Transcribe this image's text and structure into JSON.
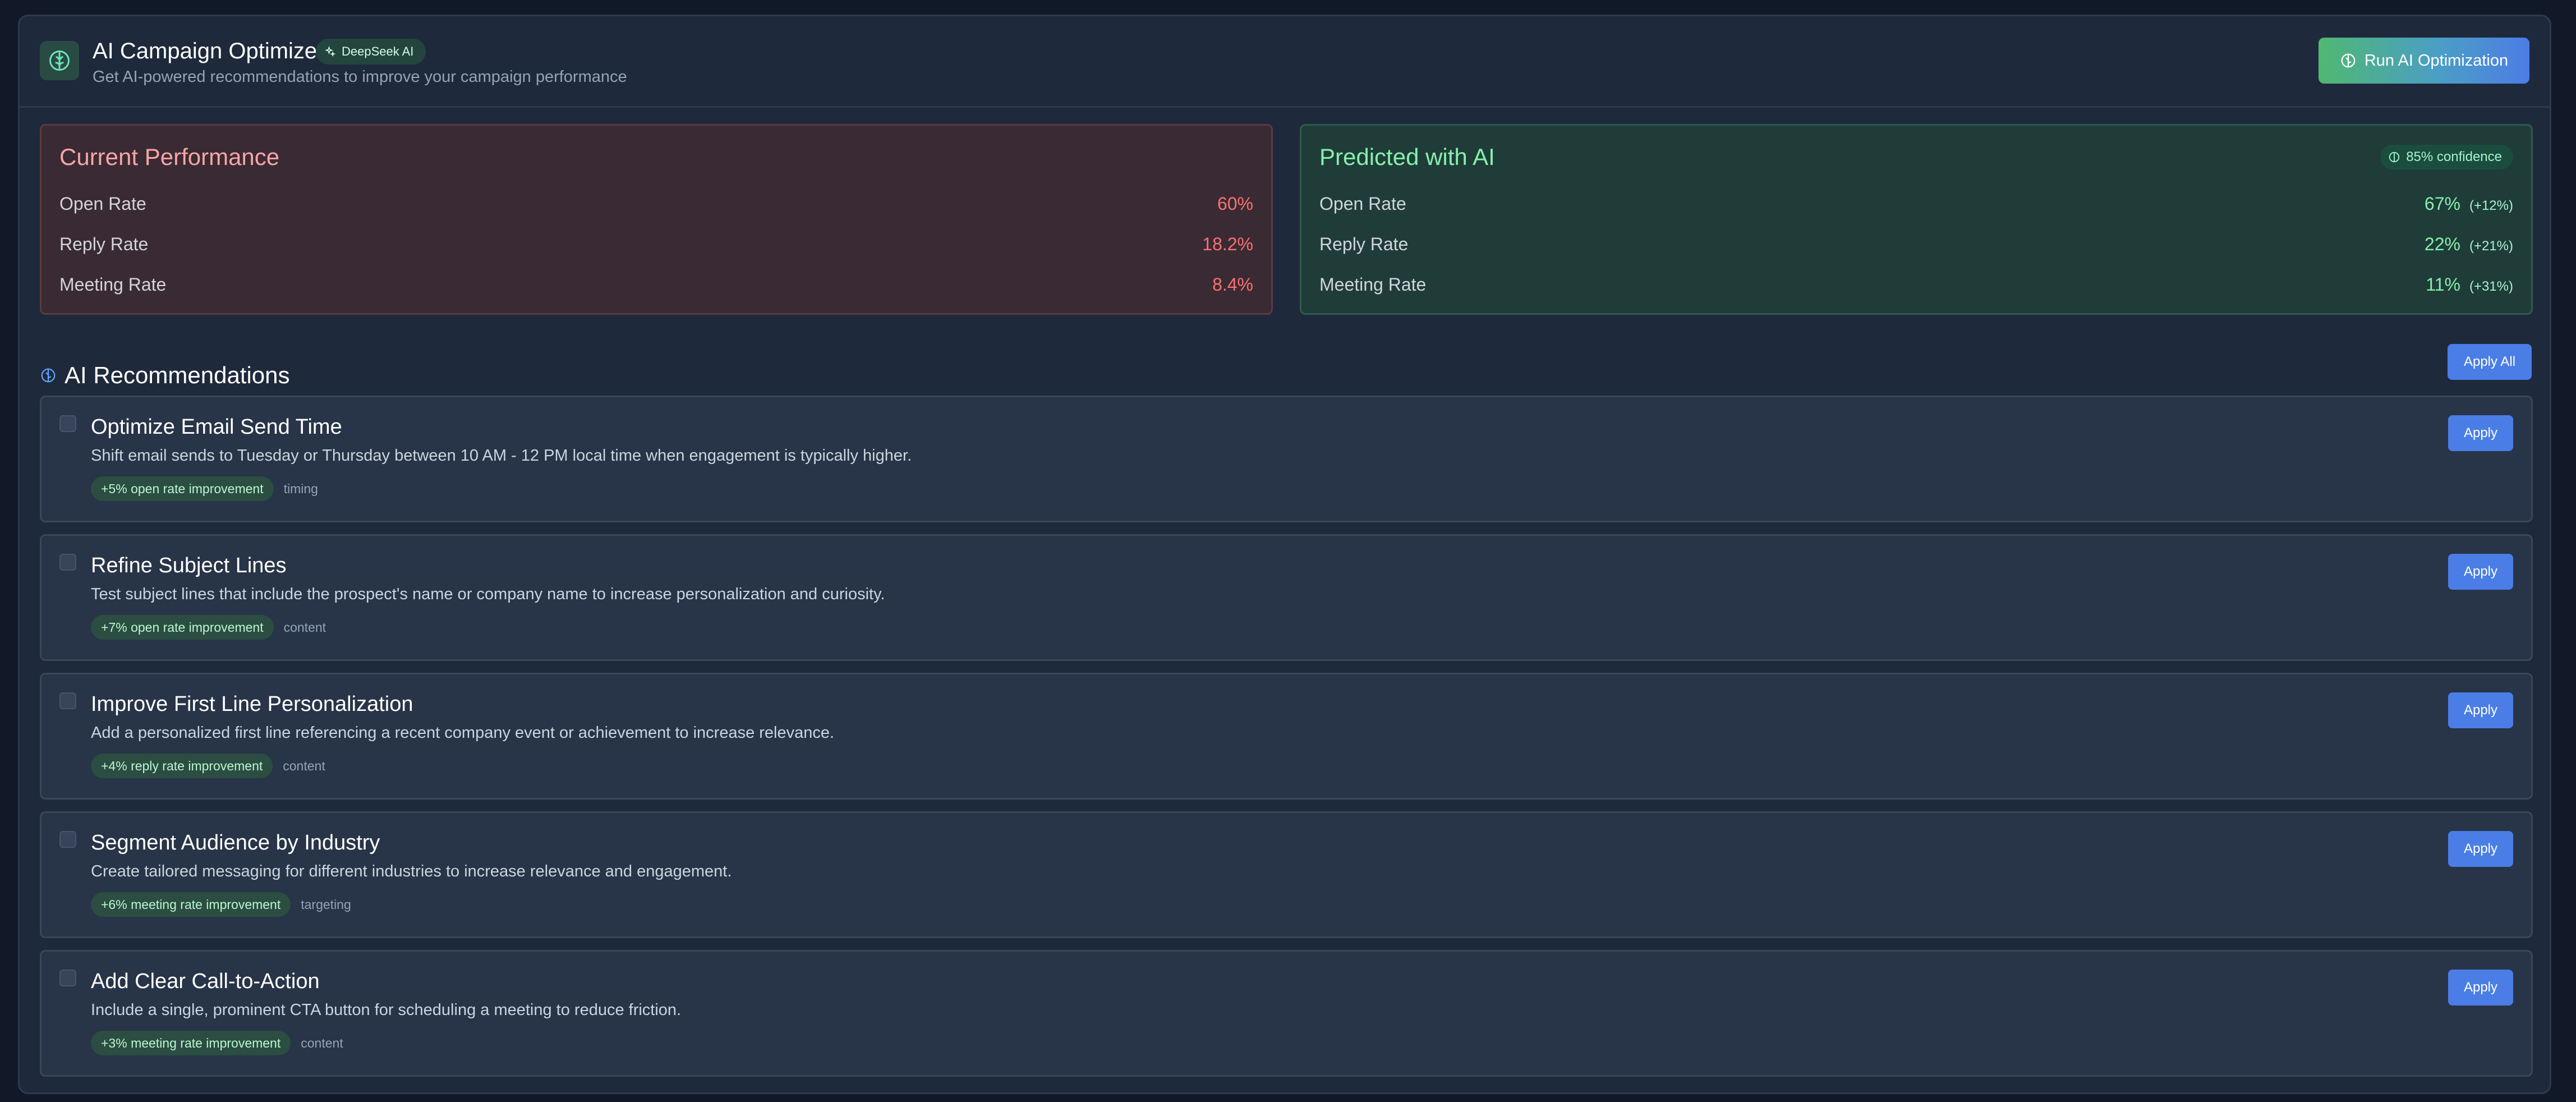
{
  "header": {
    "title": "AI Campaign Optimizer",
    "badge": "DeepSeek AI",
    "subtitle": "Get AI-powered recommendations to improve your campaign performance",
    "run_button": "Run AI Optimization"
  },
  "current": {
    "title": "Current Performance",
    "metrics": [
      {
        "label": "Open Rate",
        "value": "60%"
      },
      {
        "label": "Reply Rate",
        "value": "18.2%"
      },
      {
        "label": "Meeting Rate",
        "value": "8.4%"
      }
    ]
  },
  "predicted": {
    "title": "Predicted with AI",
    "confidence": "85% confidence",
    "metrics": [
      {
        "label": "Open Rate",
        "value": "67%",
        "delta": "(+12%)"
      },
      {
        "label": "Reply Rate",
        "value": "22%",
        "delta": "(+21%)"
      },
      {
        "label": "Meeting Rate",
        "value": "11%",
        "delta": "(+31%)"
      }
    ]
  },
  "recommendations": {
    "title": "AI Recommendations",
    "apply_all": "Apply All",
    "apply_label": "Apply",
    "items": [
      {
        "title": "Optimize Email Send Time",
        "description": "Shift email sends to Tuesday or Thursday between 10 AM - 12 PM local time when engagement is typically higher.",
        "impact": "+5% open rate improvement",
        "category": "timing"
      },
      {
        "title": "Refine Subject Lines",
        "description": "Test subject lines that include the prospect's name or company name to increase personalization and curiosity.",
        "impact": "+7% open rate improvement",
        "category": "content"
      },
      {
        "title": "Improve First Line Personalization",
        "description": "Add a personalized first line referencing a recent company event or achievement to increase relevance.",
        "impact": "+4% reply rate improvement",
        "category": "content"
      },
      {
        "title": "Segment Audience by Industry",
        "description": "Create tailored messaging for different industries to increase relevance and engagement.",
        "impact": "+6% meeting rate improvement",
        "category": "targeting"
      },
      {
        "title": "Add Clear Call-to-Action",
        "description": "Include a single, prominent CTA button for scheduling a meeting to reduce friction.",
        "impact": "+3% meeting rate improvement",
        "category": "content"
      }
    ]
  },
  "icons": {
    "logo": "brain-icon",
    "badge": "sparkles-icon",
    "run_button": "brain-icon",
    "confidence": "brain-icon",
    "recommendations": "brain-icon"
  },
  "colors": {
    "background": "#111827",
    "panel": "#1e293b",
    "accent_blue": "#4a7ee6",
    "accent_green": "#86efac",
    "accent_red": "#f87171"
  }
}
